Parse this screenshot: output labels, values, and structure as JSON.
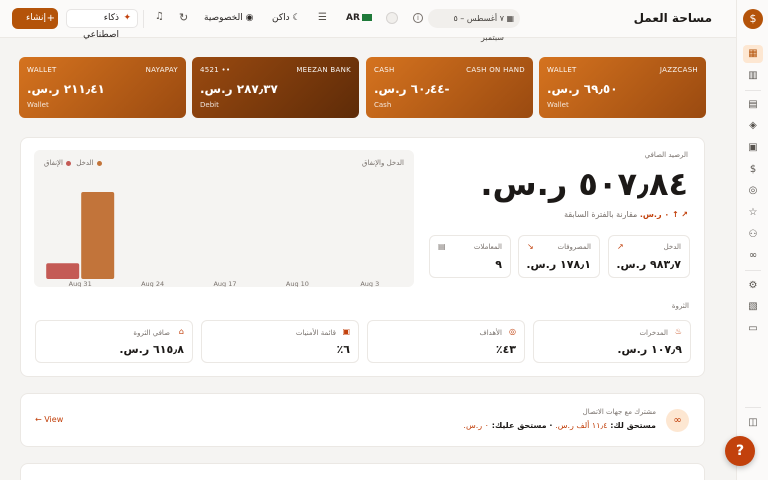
{
  "header": {
    "title": "مساحة العمل",
    "date_range": "٧ أغسطس – ٥ سبتمبر",
    "lang": "AR",
    "dark_label": "داكن",
    "privacy_label": "الخصوصية",
    "ai_label": "ذكاء اصطناعي",
    "create_label": "إنشاء"
  },
  "accounts": [
    {
      "type": "WALLET",
      "name": "JAZZCASH",
      "balance": "٦٩٫٥٠ ر.س.",
      "sub": "Wallet"
    },
    {
      "type": "CASH",
      "name": "CASH ON HAND",
      "balance": "-٦٠٫٤٤ ر.س.",
      "sub": "Cash"
    },
    {
      "type": "4521 ••",
      "name": "MEEZAN BANK",
      "balance": "٢٨٧٫٣٧ ر.س.",
      "sub": "Debit"
    },
    {
      "type": "WALLET",
      "name": "NAYAPAY",
      "balance": "٢١١٫٤١ ر.س.",
      "sub": "Wallet"
    }
  ],
  "overview": {
    "net_label": "الرصيد الصافي",
    "net_value": "٥٠٧٫٨٤ ر.س.",
    "compare_value": "↑ ٠ ر.س.",
    "compare_text": "مقارنة بالفترة السابقة",
    "stats": [
      {
        "label": "الدخل",
        "value": "٩٨٣٫٧ ر.س."
      },
      {
        "label": "المصروفات",
        "value": "١٧٨٫١ ر.س."
      },
      {
        "label": "المعاملات",
        "value": "٩"
      }
    ],
    "wealth_label": "الثروة",
    "wealth": [
      {
        "label": "المدخرات",
        "value": "١٠٧٫٩ ر.س."
      },
      {
        "label": "الأهداف",
        "value": "٤٣٪"
      },
      {
        "label": "قائمة الأمنيات",
        "value": "٦٪"
      },
      {
        "label": "صافي الثروة",
        "value": "٦١٥٫٨ ر.س."
      }
    ]
  },
  "chart_data": {
    "type": "bar",
    "title": "الدخل والإنفاق",
    "categories": [
      "Aug 3",
      "Aug 10",
      "Aug 17",
      "Aug 24",
      "Aug 31"
    ],
    "series": [
      {
        "name": "الدخل",
        "color": "#c2743a",
        "values": [
          0,
          0,
          0,
          0,
          983.7
        ]
      },
      {
        "name": "الإنفاق",
        "color": "#c45a55",
        "values": [
          0,
          0,
          0,
          0,
          178.1
        ]
      }
    ],
    "ylim": [
      0,
      983.7
    ],
    "grid": false,
    "legend": "top-left"
  },
  "contacts": {
    "title": "مشترك مع جهات الاتصال",
    "owed_to_you_label": "مستحق لك:",
    "owed_to_you": "١١٫٤ ألف ر.س.",
    "you_owe_label": "مستحق عليك:",
    "you_owe": "٠ ر.س.",
    "view_label": "View"
  }
}
